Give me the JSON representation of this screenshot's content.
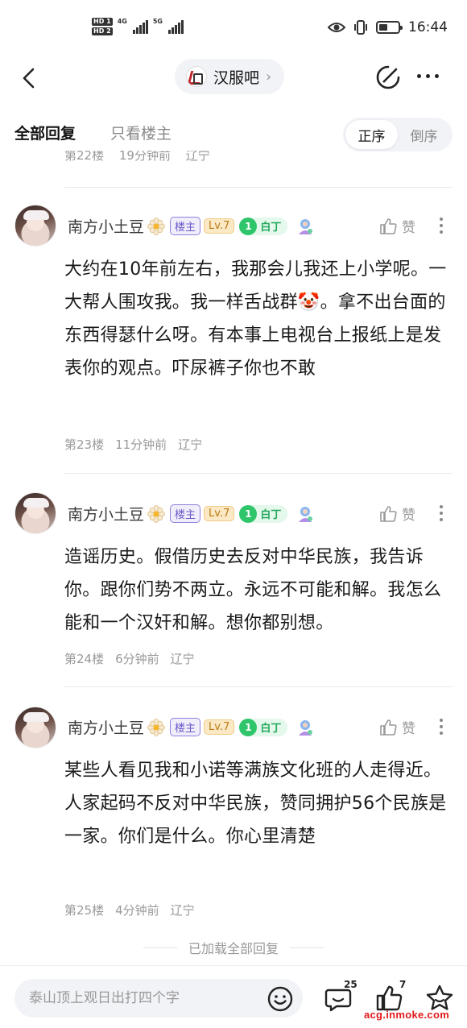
{
  "status_bar": {
    "sim_labels": [
      "HD 1",
      "HD 2"
    ],
    "network_1": "4G",
    "network_2": "5G",
    "time": "16:44",
    "battery_level": 0.45
  },
  "navbar": {
    "forum_name": "汉服吧",
    "chevron": "›"
  },
  "tabs": {
    "all_replies": "全部回复",
    "owner_only": "只看楼主",
    "order_asc": "正序",
    "order_desc": "倒序",
    "order_active": "正序"
  },
  "previous_post_meta": {
    "floor": "第22楼",
    "time": "19分钟前",
    "location": "辽宁"
  },
  "posts": [
    {
      "username": "南方小土豆",
      "owner_badge": "楼主",
      "level": "Lv.7",
      "title_number": "1",
      "title_text": "白丁",
      "like_label": "赞",
      "content": "大约在10年前左右，我那会儿我还上小学呢。一大帮人围攻我。我一样舌战群🤡。拿不出台面的东西得瑟什么呀。有本事上电视台上报纸上是发表你的观点。吓尿裤子你也不敢",
      "floor": "第23楼",
      "time": "11分钟前",
      "location": "辽宁"
    },
    {
      "username": "南方小土豆",
      "owner_badge": "楼主",
      "level": "Lv.7",
      "title_number": "1",
      "title_text": "白丁",
      "like_label": "赞",
      "content": "造谣历史。假借历史去反对中华民族，我告诉你。跟你们势不两立。永远不可能和解。我怎么能和一个汉奸和解。想你都别想。",
      "floor": "第24楼",
      "time": "6分钟前",
      "location": "辽宁"
    },
    {
      "username": "南方小土豆",
      "owner_badge": "楼主",
      "level": "Lv.7",
      "title_number": "1",
      "title_text": "白丁",
      "like_label": "赞",
      "content": "某些人看见我和小诺等满族文化班的人走得近。人家起码不反对中华民族，赞同拥护56个民族是一家。你们是什么。你心里清楚",
      "floor": "第25楼",
      "time": "4分钟前",
      "location": "辽宁"
    }
  ],
  "loaded_all": "已加载全部回复",
  "bottom_bar": {
    "reply_placeholder": "泰山顶上观日出打四个字",
    "comment_count": "25",
    "like_count": "7"
  },
  "watermark": "acg.inmoke.com",
  "colors": {
    "owner_badge": "#6a59c9",
    "level_badge": "#b87a16",
    "title_badge": "#23a85c",
    "watermark": "#e11b1b"
  },
  "icons": [
    "back-icon",
    "forum-logo",
    "edit-icon",
    "more-icon",
    "flower-icon",
    "extension-icon",
    "thumb-up-icon",
    "kebab-icon",
    "emoji-icon",
    "comment-icon",
    "star-icon"
  ]
}
